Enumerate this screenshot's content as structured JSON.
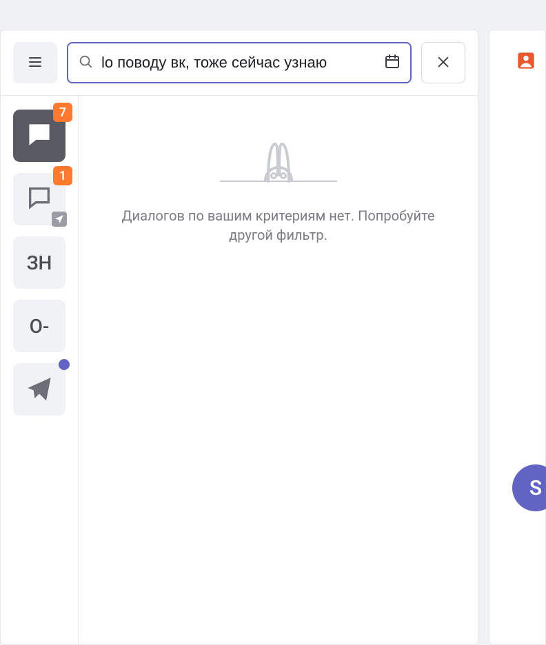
{
  "search": {
    "value": "lо поводу вк, тоже сейчас узнаю"
  },
  "sidebar": {
    "tabs": [
      {
        "kind": "icon",
        "icon": "chat-bubble",
        "badge": "7",
        "active": true
      },
      {
        "kind": "icon",
        "icon": "chat-bubble-outline",
        "badge": "1",
        "corner": true
      },
      {
        "kind": "text",
        "label": "ЗН"
      },
      {
        "kind": "text",
        "label": "О-"
      },
      {
        "kind": "icon",
        "icon": "paper-plane",
        "dot": true
      }
    ]
  },
  "empty": {
    "message": "Диалогов по вашим критериям нет. Попробуйте другой фильтр."
  },
  "fab": {
    "letter": "S"
  }
}
